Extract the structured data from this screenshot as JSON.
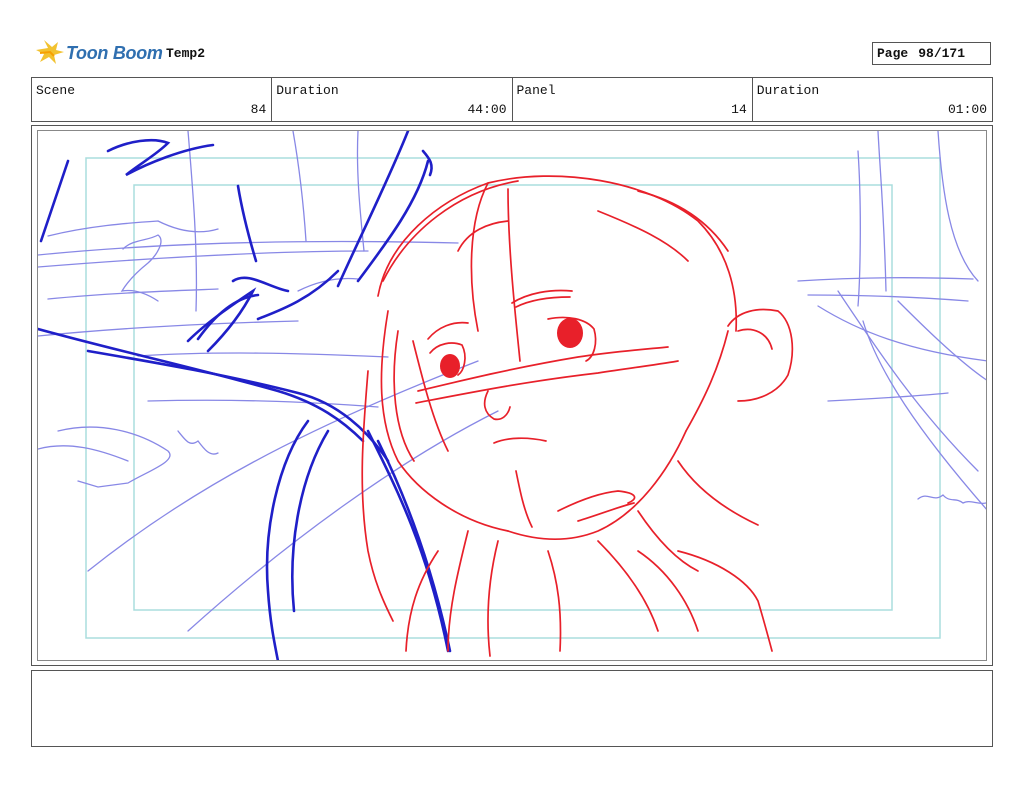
{
  "header": {
    "logo_text": "Toon Boom",
    "project_name": "Temp2",
    "page_label": "Page",
    "page_value": "98/171"
  },
  "info": {
    "scene_label": "Scene",
    "scene_value": "84",
    "scene_duration_label": "Duration",
    "scene_duration_value": "44:00",
    "panel_label": "Panel",
    "panel_value": "14",
    "panel_duration_label": "Duration",
    "panel_duration_value": "01:00"
  },
  "colors": {
    "rough_blue": "#1f1fc8",
    "light_blue": "#8888e6",
    "character_red": "#e8202a",
    "safe_frame": "#aadddd"
  },
  "notes": {
    "text": ""
  }
}
